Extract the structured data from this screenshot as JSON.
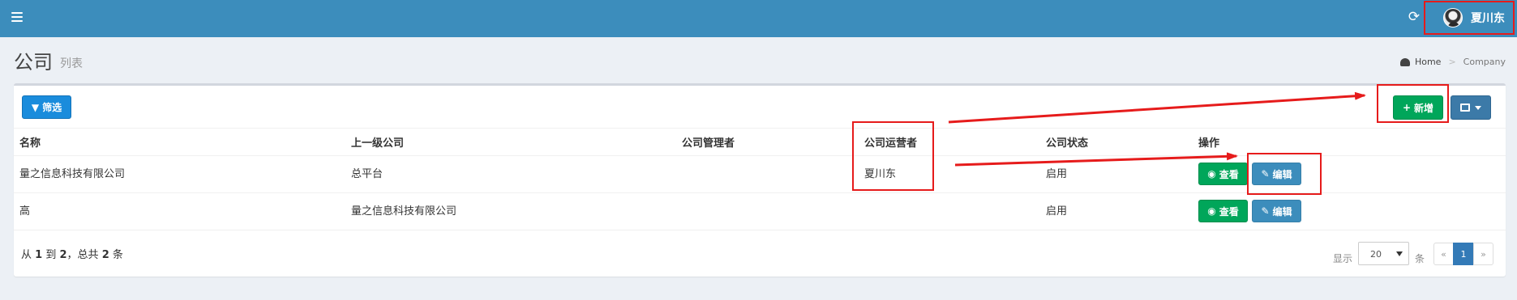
{
  "header": {
    "user_name": "夏川东",
    "refresh_glyph": "⟳"
  },
  "page": {
    "title": "公司",
    "subtitle": "列表"
  },
  "breadcrumb": {
    "home": "Home",
    "separator": ">",
    "current": "Company"
  },
  "toolbar": {
    "filter_label": "筛选",
    "add_label": "新增"
  },
  "table": {
    "columns": [
      "名称",
      "上一级公司",
      "公司管理者",
      "公司运营者",
      "公司状态",
      "操作"
    ],
    "rows": [
      {
        "name": "量之信息科技有限公司",
        "parent": "总平台",
        "manager": "",
        "operator": "夏川东",
        "status": "启用",
        "view_label": "查看",
        "edit_label": "编辑"
      },
      {
        "name": "高",
        "parent": "量之信息科技有限公司",
        "manager": "",
        "operator": "",
        "status": "启用",
        "view_label": "查看",
        "edit_label": "编辑"
      }
    ]
  },
  "footer": {
    "info_prefix": "从",
    "info_from": "1",
    "info_to_word": "到",
    "info_to": "2",
    "info_total_word": "，总共",
    "info_total": "2",
    "info_unit": "条",
    "show_label": "显示",
    "page_size": "20",
    "per_label": "条",
    "prev": "«",
    "current_page": "1",
    "next": "»"
  },
  "colors": {
    "header_bg": "#3c8dbc",
    "annotation": "#e61b1b",
    "success": "#00a65a",
    "primary": "#3c8dbc"
  }
}
